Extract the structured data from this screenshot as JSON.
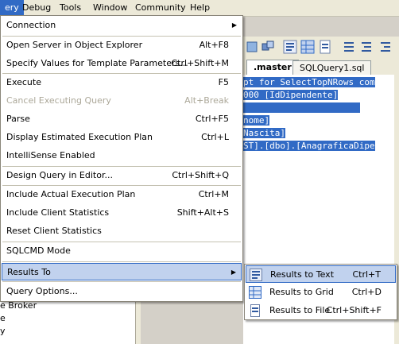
{
  "menubar": {
    "items": [
      {
        "label": "ery"
      },
      {
        "label": "Debug"
      },
      {
        "label": "Tools"
      },
      {
        "label": "Window"
      },
      {
        "label": "Community"
      },
      {
        "label": "Help"
      }
    ]
  },
  "editor": {
    "tabs": [
      {
        "label": ".master"
      },
      {
        "label": "SQLQuery1.sql"
      }
    ],
    "code_lines": [
      "pt for SelectTopNRows com",
      "000 [IdDipendente]",
      "",
      "nome]",
      "Nascita]",
      "ST].[dbo].[AnagraficaDipe"
    ]
  },
  "object_explorer": {
    "lines": [
      "e Broker",
      "e",
      "y"
    ]
  },
  "menu": {
    "items": [
      {
        "label": "Connection",
        "shortcut": "",
        "submenu": true
      },
      {
        "label": "Open Server in Object Explorer",
        "shortcut": "Alt+F8"
      },
      {
        "label": "Specify Values for Template Parameters...",
        "shortcut": "Ctrl+Shift+M"
      },
      {
        "label": "Execute",
        "shortcut": "F5"
      },
      {
        "label": "Cancel Executing Query",
        "shortcut": "Alt+Break",
        "disabled": true
      },
      {
        "label": "Parse",
        "shortcut": "Ctrl+F5"
      },
      {
        "label": "Display Estimated Execution Plan",
        "shortcut": "Ctrl+L"
      },
      {
        "label": "IntelliSense Enabled",
        "shortcut": ""
      },
      {
        "label": "Design Query in Editor...",
        "shortcut": "Ctrl+Shift+Q"
      },
      {
        "label": "Include Actual Execution Plan",
        "shortcut": "Ctrl+M"
      },
      {
        "label": "Include Client Statistics",
        "shortcut": "Shift+Alt+S"
      },
      {
        "label": "Reset Client Statistics",
        "shortcut": ""
      },
      {
        "label": "SQLCMD Mode",
        "shortcut": ""
      },
      {
        "label": "Results To",
        "shortcut": "",
        "submenu": true,
        "highlighted": true
      },
      {
        "label": "Query Options...",
        "shortcut": ""
      }
    ]
  },
  "submenu": {
    "items": [
      {
        "label": "Results to Text",
        "shortcut": "Ctrl+T",
        "icon": "results-text-icon",
        "highlighted": true
      },
      {
        "label": "Results to Grid",
        "shortcut": "Ctrl+D",
        "icon": "results-grid-icon"
      },
      {
        "label": "Results to File",
        "shortcut": "Ctrl+Shift+F",
        "icon": "results-file-icon"
      }
    ]
  },
  "colors": {
    "highlight": "#c1d2ee",
    "highlight_border": "#316ac5",
    "selection": "#316ac5",
    "disabled_text": "#aca899"
  }
}
